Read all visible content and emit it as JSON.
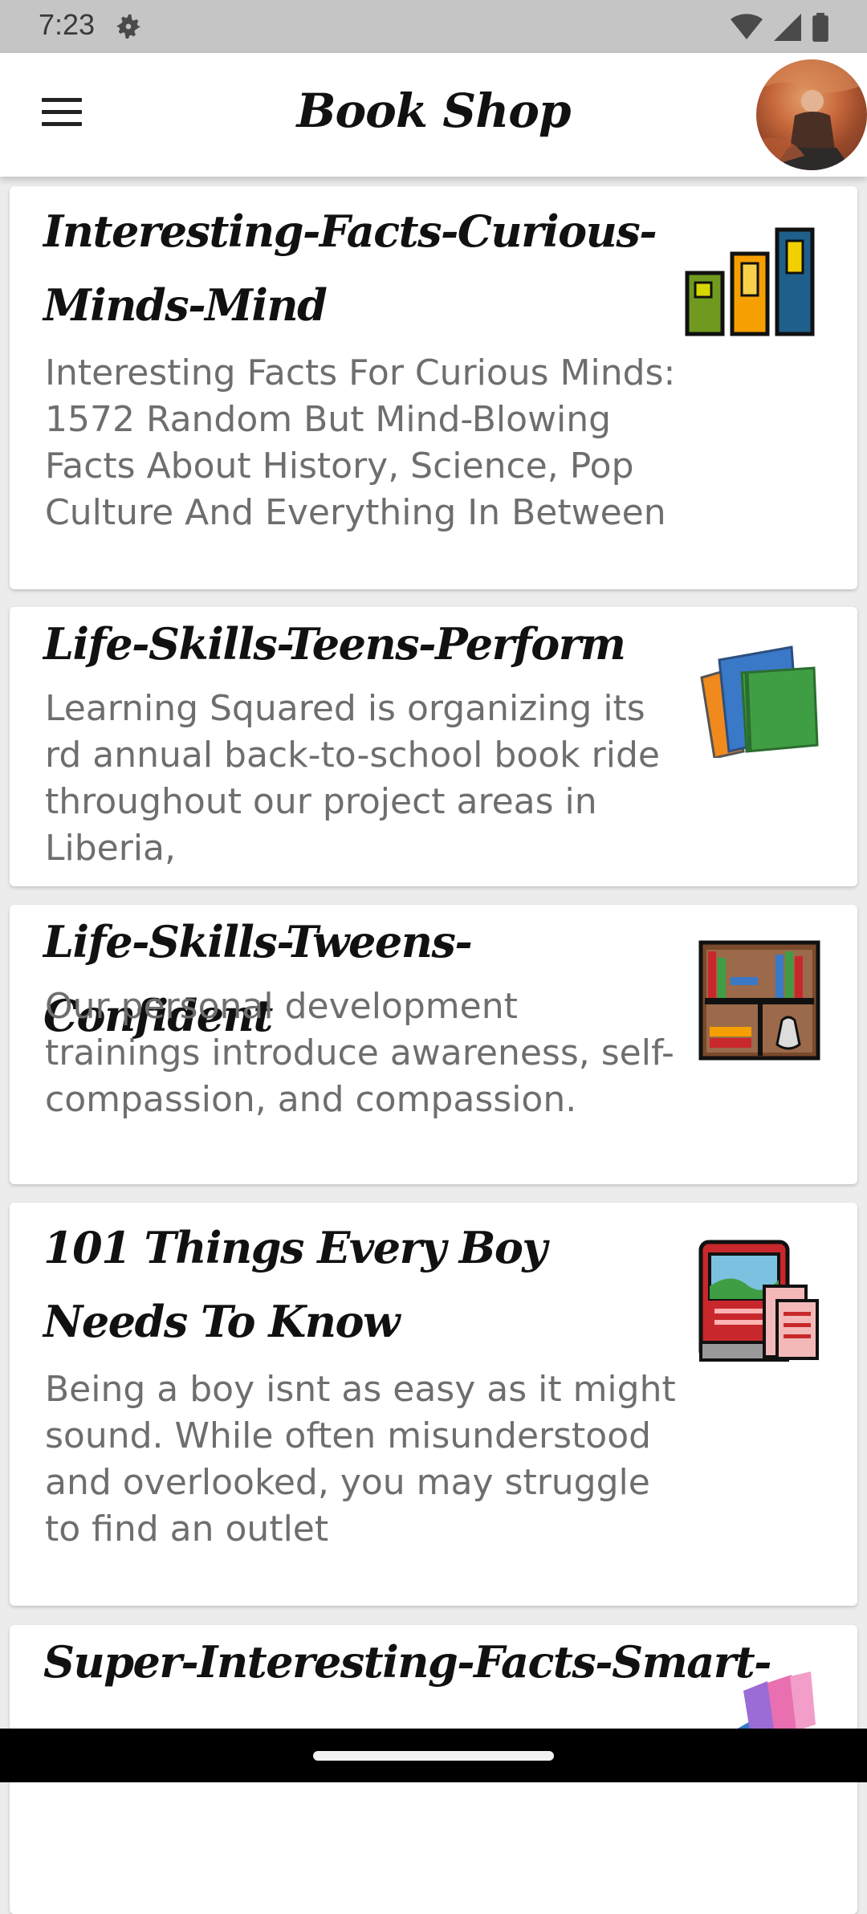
{
  "status": {
    "time": "7:23"
  },
  "app": {
    "title": "Book Shop"
  },
  "books": [
    {
      "title": "Interesting-Facts-Curious-Minds-Mind",
      "description": "Interesting Facts For Curious Minds: 1572 Random But Mind-Blowing Facts About History, Science, Pop Culture And Everything In Between",
      "icon": "bar-books-icon"
    },
    {
      "title": "Life-Skills-Teens-Perform",
      "description": "Learning Squared is organizing its rd annual back-to-school book ride throughout our project areas in Liberia,",
      "icon": "stacked-books-icon"
    },
    {
      "title": "Life-Skills-Tweens-Confident",
      "description": "Our personal development trainings introduce awareness, self-compassion, and compassion.",
      "icon": "bookshelf-icon"
    },
    {
      "title": "101 Things Every Boy Needs To Know",
      "description": "Being a boy isnt as easy as it might sound. While often misunderstood and overlooked, you may struggle to find an outlet",
      "icon": "picture-book-icon"
    },
    {
      "title": "Super-Interesting-Facts-Smart-",
      "description": "",
      "icon": "colorful-books-icon"
    }
  ],
  "colors": {
    "accent": "#111111",
    "description": "#6e6e6e",
    "background": "#ececec"
  }
}
